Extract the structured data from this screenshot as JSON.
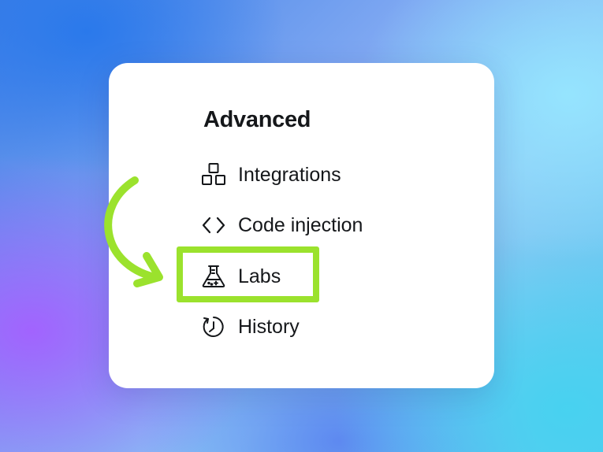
{
  "section": {
    "title": "Advanced"
  },
  "menu": {
    "items": [
      {
        "label": "Integrations",
        "icon": "integrations-icon"
      },
      {
        "label": "Code injection",
        "icon": "code-icon"
      },
      {
        "label": "Labs",
        "icon": "flask-icon",
        "highlighted": true
      },
      {
        "label": "History",
        "icon": "history-icon"
      }
    ]
  },
  "annotation": {
    "color": "#9be22d",
    "target": "Labs"
  }
}
